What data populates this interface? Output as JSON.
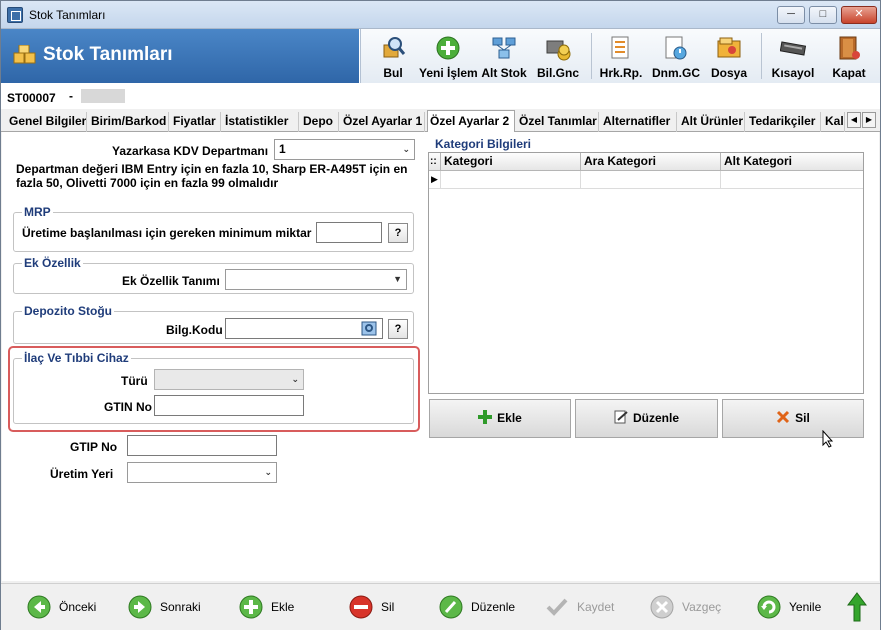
{
  "window": {
    "title": "Stok Tanımları",
    "controls": {
      "minimize": "─",
      "maximize": "□",
      "close": "✕"
    }
  },
  "header": {
    "title": "Stok Tanımları",
    "toolbar": [
      {
        "label": "Bul",
        "icon": "find-icon"
      },
      {
        "label": "Yeni İşlem",
        "icon": "plus-circle-icon"
      },
      {
        "label": "Alt Stok",
        "icon": "substock-icon"
      },
      {
        "label": "Bil.Gnc",
        "icon": "update-icon"
      },
      {
        "label": "Hrk.Rp.",
        "icon": "report-icon"
      },
      {
        "label": "Dnm.GC",
        "icon": "period-icon"
      },
      {
        "label": "Dosya",
        "icon": "file-icon"
      },
      {
        "label": "Kısayol",
        "icon": "keyboard-icon"
      },
      {
        "label": "Kapat",
        "icon": "exit-icon"
      }
    ]
  },
  "record": {
    "code": "ST00007",
    "separator": "-"
  },
  "tabs": [
    {
      "label": "Genel Bilgiler"
    },
    {
      "label": "Birim/Barkod"
    },
    {
      "label": "Fiyatlar"
    },
    {
      "label": "İstatistikler"
    },
    {
      "label": "Depo"
    },
    {
      "label": "Özel Ayarlar 1"
    },
    {
      "label": "Özel Ayarlar 2",
      "active": true
    },
    {
      "label": "Özel Tanımlar"
    },
    {
      "label": "Alternatifler"
    },
    {
      "label": "Alt Ürünler"
    },
    {
      "label": "Tedarikçiler"
    },
    {
      "label": "Kali"
    }
  ],
  "tab_nav": {
    "left": "◀",
    "right": "▶"
  },
  "form": {
    "kdv_label": "Yazarkasa KDV Departmanı",
    "kdv_value": "1",
    "kdv_note": "Departman değeri IBM Entry için en fazla 10, Sharp ER-A495T için en fazla 50, Olivetti 7000 için en fazla 99 olmalıdır",
    "mrp": {
      "title": "MRP",
      "label": "Üretime başlanılması için gereken minimum miktar",
      "value": "",
      "help": "?"
    },
    "ek_ozellik": {
      "title": "Ek Özellik",
      "label": "Ek Özellik Tanımı",
      "value": ""
    },
    "depozito": {
      "title": "Depozito Stoğu",
      "label": "Bilg.Kodu",
      "value": "",
      "help": "?"
    },
    "ilac": {
      "title": "İlaç Ve Tıbbi Cihaz",
      "turu_label": "Türü",
      "turu_value": "",
      "gtin_label": "GTIN No",
      "gtin_value": ""
    },
    "gtip_label": "GTIP No",
    "gtip_value": "",
    "uretim_label": "Üretim Yeri",
    "uretim_value": ""
  },
  "kategori": {
    "title": "Kategori Bilgileri",
    "columns": [
      "Kategori",
      "Ara Kategori",
      "Alt Kategori"
    ],
    "row_indicator": "▶",
    "corner": "::",
    "buttons": {
      "add": "Ekle",
      "edit": "Düzenle",
      "delete": "Sil"
    }
  },
  "footer": [
    {
      "label": "Önceki",
      "icon": "back-arrow-icon",
      "enabled": true
    },
    {
      "label": "Sonraki",
      "icon": "forward-arrow-icon",
      "enabled": true
    },
    {
      "label": "Ekle",
      "icon": "add-icon",
      "enabled": true
    },
    {
      "label": "Sil",
      "icon": "remove-icon",
      "enabled": true
    },
    {
      "label": "Düzenle",
      "icon": "edit-icon",
      "enabled": true
    },
    {
      "label": "Kaydet",
      "icon": "check-icon",
      "enabled": false
    },
    {
      "label": "Vazgeç",
      "icon": "cancel-icon",
      "enabled": false
    },
    {
      "label": "Yenile",
      "icon": "refresh-icon",
      "enabled": true
    }
  ],
  "colors": {
    "accent": "#2f66a8",
    "highlight": "#d85c5c",
    "group_title": "#1f3c7a"
  }
}
